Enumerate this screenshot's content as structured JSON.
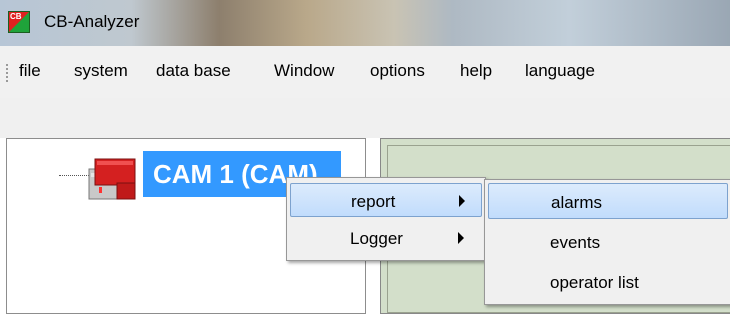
{
  "window": {
    "title": "CB-Analyzer",
    "icon": "cb-app-icon",
    "icon_text": "CB"
  },
  "menubar": {
    "items": [
      {
        "label": "file"
      },
      {
        "label": "system"
      },
      {
        "label": "data base"
      },
      {
        "label": "Window"
      },
      {
        "label": "options"
      },
      {
        "label": "help"
      },
      {
        "label": "language"
      }
    ]
  },
  "tree": {
    "node": {
      "label": "CAM 1 (CAM)",
      "icon": "device-module-icon"
    }
  },
  "context_menu": {
    "items": [
      {
        "label": "report",
        "icon": "submenu-arrow-icon"
      },
      {
        "label": "Logger",
        "icon": "submenu-arrow-icon"
      }
    ]
  },
  "submenu": {
    "items": [
      {
        "label": "alarms"
      },
      {
        "label": "events"
      },
      {
        "label": "operator list"
      }
    ]
  },
  "colors": {
    "selection": "#3399ff",
    "menu_highlight": "#c1dcfc",
    "panel_green": "#d3dfca"
  }
}
